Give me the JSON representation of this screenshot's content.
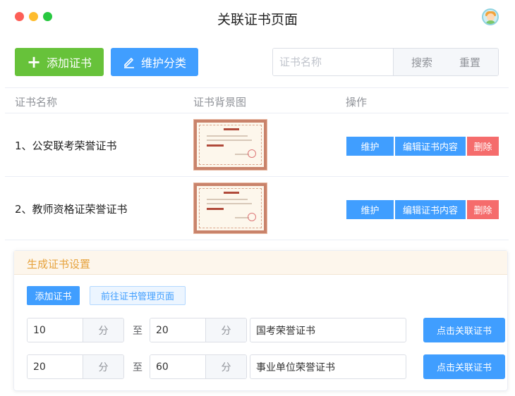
{
  "window": {
    "title": "关联证书页面"
  },
  "toolbar": {
    "add_label": "添加证书",
    "maintain_label": "维护分类",
    "search_placeholder": "证书名称",
    "search_label": "搜索",
    "reset_label": "重置"
  },
  "table": {
    "headers": [
      "证书名称",
      "证书背景图",
      "操作"
    ],
    "rows": [
      {
        "name": "1、公安联考荣誉证书",
        "actions": [
          "维护",
          "编辑证书内容",
          "删除"
        ]
      },
      {
        "name": "2、教师资格证荣誉证书",
        "actions": [
          "维护",
          "编辑证书内容",
          "删除"
        ]
      }
    ]
  },
  "settings": {
    "title": "生成证书设置",
    "add_label": "添加证书",
    "goto_label": "前往证书管理页面",
    "rows": [
      {
        "from": "10",
        "unit1": "分",
        "to_label": "至",
        "to": "20",
        "unit2": "分",
        "cert": "国考荣誉证书",
        "button": "点击关联证书"
      },
      {
        "from": "20",
        "unit1": "分",
        "to_label": "至",
        "to": "60",
        "unit2": "分",
        "cert": "事业单位荣誉证书",
        "button": "点击关联证书"
      }
    ]
  },
  "colors": {
    "green": "#67c23a",
    "blue": "#409eff",
    "red": "#f56c6c",
    "orange": "#e6a23c"
  }
}
